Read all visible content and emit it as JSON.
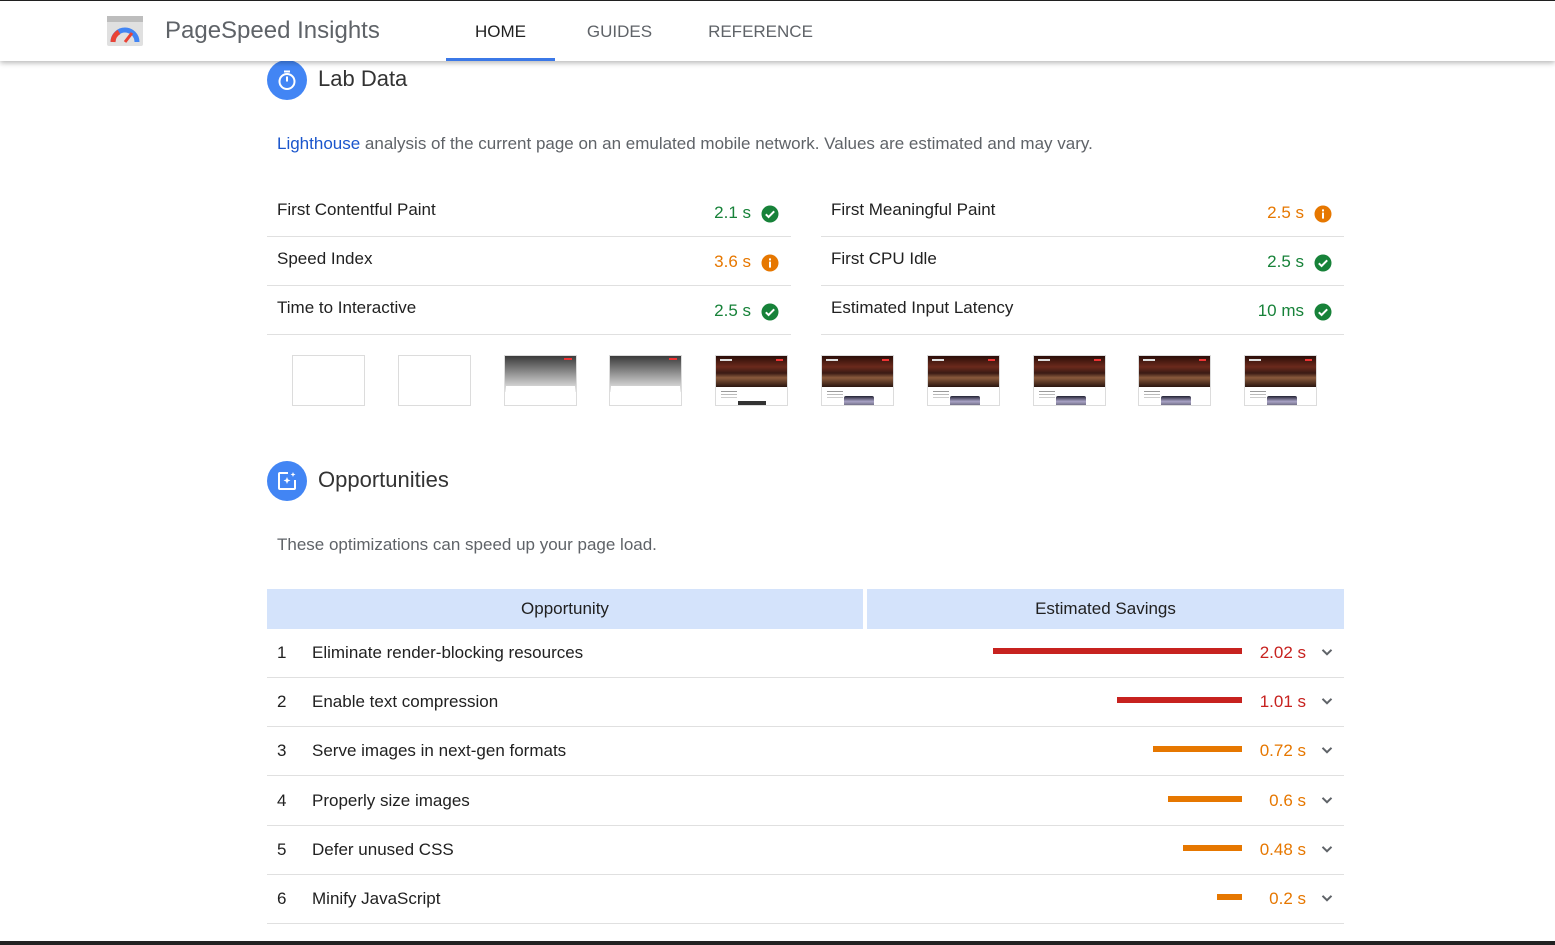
{
  "header": {
    "app_title": "PageSpeed Insights",
    "tabs": [
      {
        "label": "HOME",
        "active": true
      },
      {
        "label": "GUIDES",
        "active": false
      },
      {
        "label": "REFERENCE",
        "active": false
      }
    ]
  },
  "lab_data": {
    "title": "Lab Data",
    "icon": "stopwatch-icon",
    "description_link": "Lighthouse",
    "description_rest": " analysis of the current page on an emulated mobile network. Values are estimated and may vary.",
    "metrics_left": [
      {
        "label": "First Contentful Paint",
        "value": "2.1 s",
        "status": "good"
      },
      {
        "label": "Speed Index",
        "value": "3.6 s",
        "status": "average"
      },
      {
        "label": "Time to Interactive",
        "value": "2.5 s",
        "status": "good"
      }
    ],
    "metrics_right": [
      {
        "label": "First Meaningful Paint",
        "value": "2.5 s",
        "status": "average"
      },
      {
        "label": "First CPU Idle",
        "value": "2.5 s",
        "status": "good"
      },
      {
        "label": "Estimated Input Latency",
        "value": "10 ms",
        "status": "good"
      }
    ],
    "filmstrip_frames": [
      "blank",
      "blank",
      "gradient",
      "gradient",
      "page-loading",
      "page-loaded",
      "page-loaded",
      "page-loaded",
      "page-loaded",
      "page-loaded"
    ]
  },
  "opportunities": {
    "title": "Opportunities",
    "icon": "opportunity-icon",
    "description": "These optimizations can speed up your page load.",
    "col_opportunity": "Opportunity",
    "col_savings": "Estimated Savings",
    "rows": [
      {
        "num": "1",
        "label": "Eliminate render-blocking resources",
        "savings": "2.02 s",
        "seconds": 2.02,
        "severity": "bad"
      },
      {
        "num": "2",
        "label": "Enable text compression",
        "savings": "1.01 s",
        "seconds": 1.01,
        "severity": "bad"
      },
      {
        "num": "3",
        "label": "Serve images in next-gen formats",
        "savings": "0.72 s",
        "seconds": 0.72,
        "severity": "average"
      },
      {
        "num": "4",
        "label": "Properly size images",
        "savings": "0.6 s",
        "seconds": 0.6,
        "severity": "average"
      },
      {
        "num": "5",
        "label": "Defer unused CSS",
        "savings": "0.48 s",
        "seconds": 0.48,
        "severity": "average"
      },
      {
        "num": "6",
        "label": "Minify JavaScript",
        "savings": "0.2 s",
        "seconds": 0.2,
        "severity": "average"
      }
    ]
  },
  "colors": {
    "good": "#178239",
    "average": "#e67700",
    "bad": "#c7221f",
    "accent": "#4285f4",
    "table_header": "#d4e3fb"
  }
}
